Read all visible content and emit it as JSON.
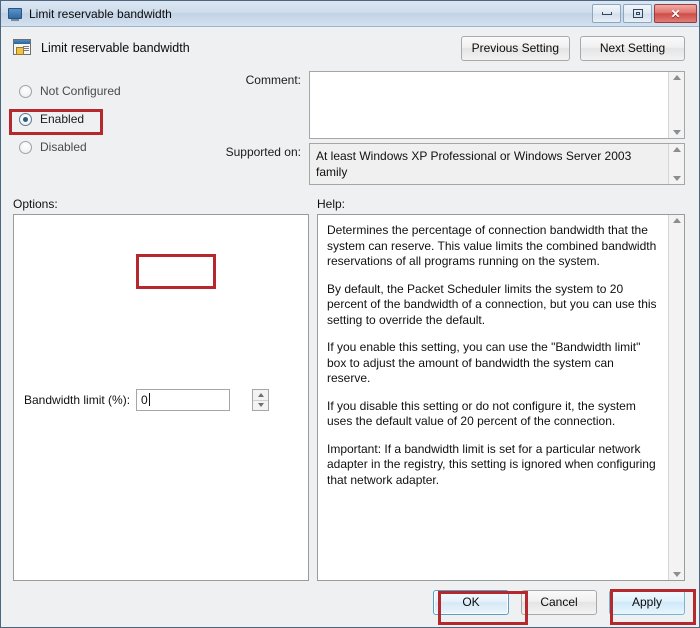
{
  "window": {
    "title": "Limit reservable bandwidth",
    "title_icon": "policy-window-icon",
    "minimize_label": "",
    "maximize_label": "",
    "close_label": "✕"
  },
  "header": {
    "icon": "policy-setting-icon",
    "title": "Limit reservable bandwidth",
    "previous_button": "Previous Setting",
    "next_button": "Next Setting"
  },
  "state": {
    "options": [
      {
        "label": "Not Configured",
        "selected": false
      },
      {
        "label": "Enabled",
        "selected": true
      },
      {
        "label": "Disabled",
        "selected": false
      }
    ]
  },
  "comment": {
    "label": "Comment:",
    "value": "",
    "placeholder": ""
  },
  "supported_on": {
    "label": "Supported on:",
    "value": "At least Windows XP Professional or Windows Server 2003 family"
  },
  "options_section": {
    "label": "Options:",
    "field_label": "Bandwidth limit (%):",
    "field_value": "0"
  },
  "help_section": {
    "label": "Help:",
    "paragraphs": [
      "Determines the percentage of connection bandwidth that the system can reserve. This value limits the combined bandwidth reservations of all programs running on the system.",
      "By default, the Packet Scheduler limits the system to 20 percent of the bandwidth of a connection, but you can use this setting to override the default.",
      "If you enable this setting, you can use the \"Bandwidth limit\" box to adjust the amount of bandwidth the system can reserve.",
      "If you disable this setting or do not configure it, the system uses the default value of 20 percent of the connection.",
      "Important: If a bandwidth limit is set for a particular network adapter in the registry, this setting is ignored when configuring that network adapter."
    ]
  },
  "footer": {
    "ok": "OK",
    "cancel": "Cancel",
    "apply": "Apply"
  },
  "annotations": {
    "color": "#b5292e",
    "boxes": [
      {
        "name": "enabled-radio-highlight"
      },
      {
        "name": "bandwidth-input-highlight"
      },
      {
        "name": "ok-button-highlight"
      },
      {
        "name": "apply-button-highlight"
      }
    ]
  }
}
